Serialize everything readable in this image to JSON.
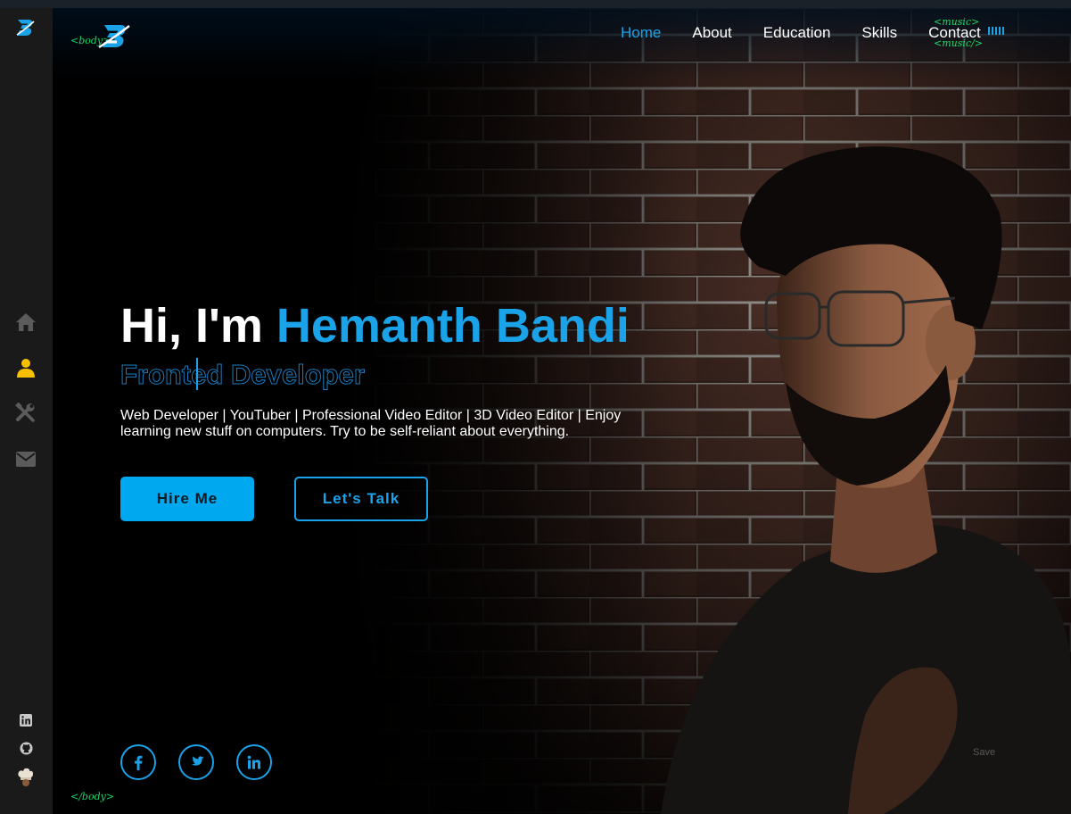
{
  "sidebar": {
    "logo_icon": "b-logo-icon",
    "nav_items": [
      {
        "icon": "home-icon",
        "active": false
      },
      {
        "icon": "user-icon",
        "active": true
      },
      {
        "icon": "tools-icon",
        "active": false
      },
      {
        "icon": "mail-icon",
        "active": false
      }
    ],
    "social_items": [
      {
        "icon": "linkedin-icon"
      },
      {
        "icon": "github-icon"
      },
      {
        "icon": "chef-icon"
      }
    ],
    "active_color": "#f6c000"
  },
  "header": {
    "body_open_tag": "<body>",
    "nav": [
      {
        "label": "Home",
        "active": true
      },
      {
        "label": "About",
        "active": false
      },
      {
        "label": "Education",
        "active": false
      },
      {
        "label": "Skills",
        "active": false
      },
      {
        "label": "Contact",
        "active": false
      }
    ],
    "music_open_tag": "<music>",
    "music_close_tag": "<music/>"
  },
  "hero": {
    "greeting_prefix": "Hi, I'm ",
    "name": "Hemanth Bandi",
    "role": "Fronted Developer",
    "bio": "Web Developer | YouTuber | Professional Video Editor | 3D Video Editor | Enjoy learning new stuff on computers. Try to be self-reliant about everything.",
    "hire_label": "Hire Me",
    "talk_label": "Let's Talk",
    "socials": [
      {
        "icon": "facebook-icon"
      },
      {
        "icon": "twitter-icon"
      },
      {
        "icon": "linkedin-icon"
      }
    ],
    "save_label": "Save",
    "body_close_tag": "</body>"
  },
  "colors": {
    "accent": "#1aa3e8",
    "tag_green": "#1bd96b",
    "sidebar_bg": "#1a1a1a"
  }
}
